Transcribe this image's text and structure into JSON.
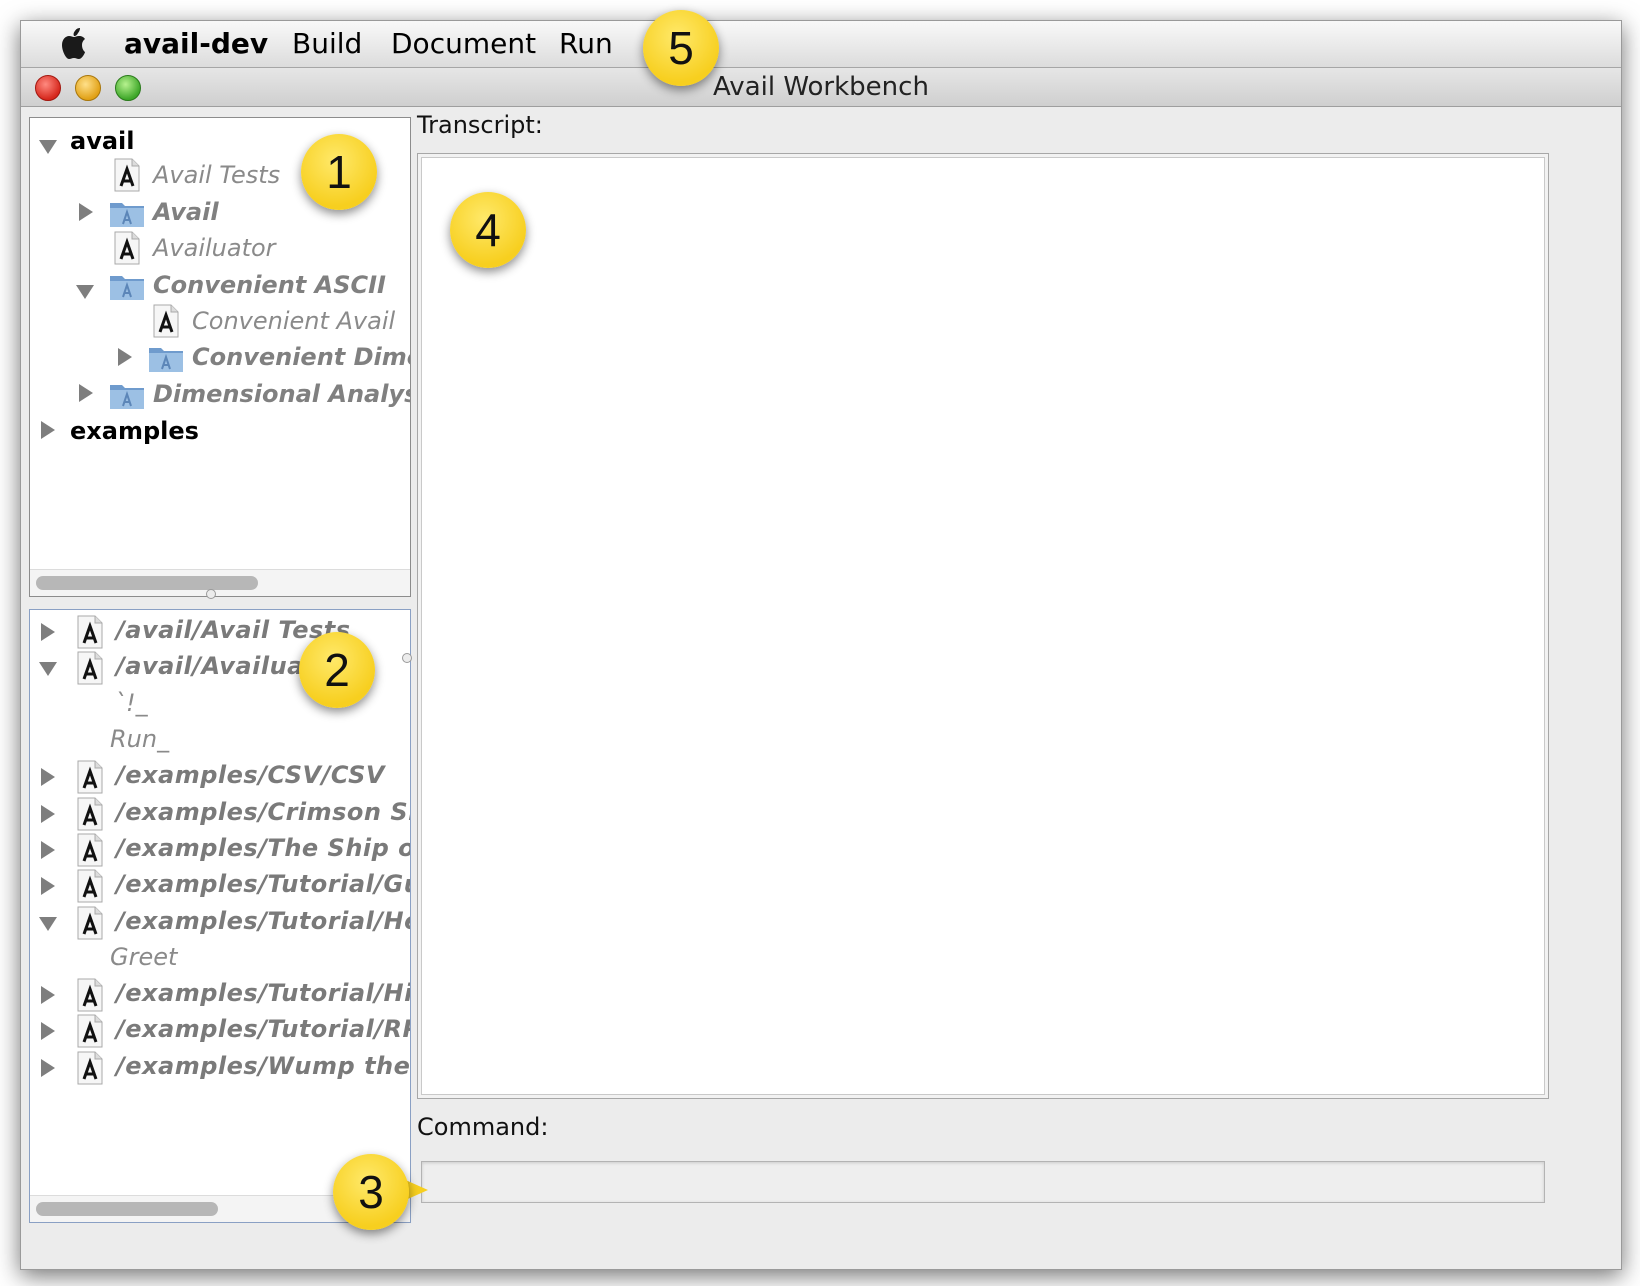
{
  "menubar": {
    "app_name": "avail-dev",
    "items": [
      {
        "label": "Build"
      },
      {
        "label": "Document"
      },
      {
        "label": "Run"
      }
    ]
  },
  "window": {
    "title": "Avail Workbench"
  },
  "module_tree": {
    "rows": [
      {
        "label": "avail",
        "kind": "root",
        "expanded": true
      },
      {
        "label": "Avail Tests",
        "kind": "module"
      },
      {
        "label": "Avail",
        "kind": "package",
        "expanded": false
      },
      {
        "label": "Availuator",
        "kind": "module"
      },
      {
        "label": "Convenient ASCII",
        "kind": "package",
        "expanded": true
      },
      {
        "label": "Convenient Avail",
        "kind": "module"
      },
      {
        "label": "Convenient Dime",
        "kind": "package",
        "expanded": false
      },
      {
        "label": "Dimensional Analys.",
        "kind": "package",
        "expanded": false
      },
      {
        "label": "examples",
        "kind": "root",
        "expanded": false
      }
    ]
  },
  "entry_tree": {
    "rows": [
      {
        "label": "/avail/Avail Tests",
        "kind": "entry-module",
        "expanded": false
      },
      {
        "label": "/avail/Availuato",
        "kind": "entry-module",
        "expanded": true
      },
      {
        "label": "`!_",
        "kind": "entry-point"
      },
      {
        "label": "Run_",
        "kind": "entry-point"
      },
      {
        "label": "/examples/CSV/CSV",
        "kind": "entry-module",
        "expanded": false
      },
      {
        "label": "/examples/Crimson Sh",
        "kind": "entry-module",
        "expanded": false
      },
      {
        "label": "/examples/The Ship of",
        "kind": "entry-module",
        "expanded": false
      },
      {
        "label": "/examples/Tutorial/Gu",
        "kind": "entry-module",
        "expanded": false
      },
      {
        "label": "/examples/Tutorial/He",
        "kind": "entry-module",
        "expanded": true
      },
      {
        "label": "Greet",
        "kind": "entry-point"
      },
      {
        "label": "/examples/Tutorial/Hi",
        "kind": "entry-module",
        "expanded": false
      },
      {
        "label": "/examples/Tutorial/RP",
        "kind": "entry-module",
        "expanded": false
      },
      {
        "label": "/examples/Wump the W",
        "kind": "entry-module",
        "expanded": false
      }
    ]
  },
  "transcript": {
    "label": "Transcript:",
    "content": ""
  },
  "command": {
    "label": "Command:",
    "value": ""
  },
  "callouts": [
    "1",
    "2",
    "3",
    "4",
    "5"
  ],
  "colors": {
    "callout": "#f7cf1f",
    "window_bg": "#ececec",
    "close": "#d6281d",
    "minimize": "#e1a116",
    "maximize": "#3ea729"
  }
}
